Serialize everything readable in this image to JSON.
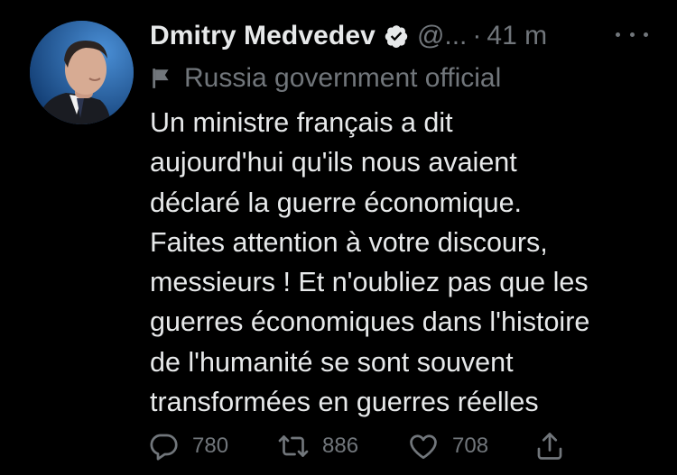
{
  "tweet": {
    "author": {
      "display_name": "Dmitry Medvedev",
      "handle": "@...",
      "separator": "·",
      "time": "41 m",
      "verified": true
    },
    "label": "Russia government official",
    "lines": [
      "Un ministre français a dit",
      "aujourd'hui qu'ils nous avaient",
      "déclaré la guerre économique.",
      "Faites attention à votre discours,",
      "messieurs ! Et n'oubliez pas que les",
      "guerres économiques dans l'histoire",
      "de l'humanité se sont souvent",
      "transformées en guerres réelles"
    ],
    "metrics": {
      "replies": "780",
      "retweets": "886",
      "likes": "708"
    }
  },
  "icons": {
    "verified": "verified-badge-icon",
    "label": "flag-icon",
    "more": "more-icon",
    "reply": "reply-icon",
    "retweet": "retweet-icon",
    "like": "heart-icon",
    "share": "share-icon"
  },
  "colors": {
    "background": "#000000",
    "primary_text": "#e7e9ea",
    "secondary_text": "#71767b"
  }
}
